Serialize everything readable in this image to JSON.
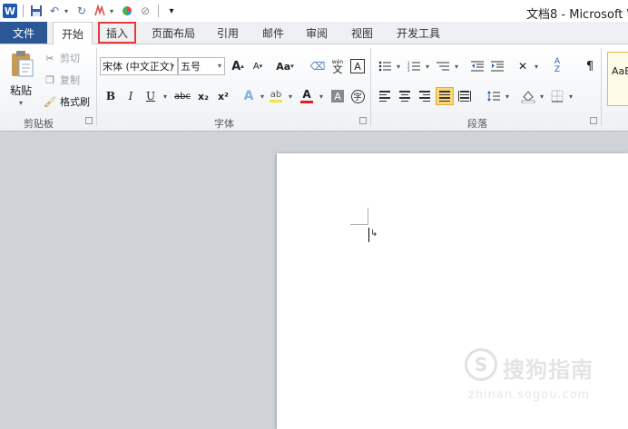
{
  "window": {
    "title": "文档8 - Microsoft W"
  },
  "quick_access": {
    "app_icon_letter": "W",
    "customize_symbol": "▾"
  },
  "tabs": {
    "file": "文件",
    "home": "开始",
    "insert": "插入",
    "page_layout": "页面布局",
    "references": "引用",
    "mailings": "邮件",
    "review": "审阅",
    "view": "视图",
    "developer": "开发工具",
    "active": "home",
    "highlighted": "insert"
  },
  "clipboard": {
    "paste": "粘贴",
    "cut": "剪切",
    "copy": "复制",
    "format_painter": "格式刷",
    "group_label": "剪贴板"
  },
  "font": {
    "font_name": "宋体 (中文正文)",
    "font_size": "五号",
    "grow": "A",
    "shrink": "A",
    "change_case": "Aa",
    "bold": "B",
    "italic": "I",
    "underline": "U",
    "strikethrough": "abc",
    "subscript": "x₂",
    "superscript": "x²",
    "text_effect": "A",
    "font_color": "A",
    "char_shading": "A",
    "enclose": "字",
    "phonetic": "wén",
    "group_label": "字体"
  },
  "paragraph": {
    "group_label": "段落"
  },
  "styles": {
    "preview": "AaB"
  },
  "colors": {
    "file_tab": "#2b5797",
    "highlight_border": "#e43b3b",
    "justify_active": "#fbd67a",
    "font_color_bar": "#e02020",
    "highlight_bar": "#f7e04a"
  },
  "watermark": {
    "brand": "搜狗指南",
    "url": "zhinan.sogou.com",
    "logo_letter": "S"
  }
}
